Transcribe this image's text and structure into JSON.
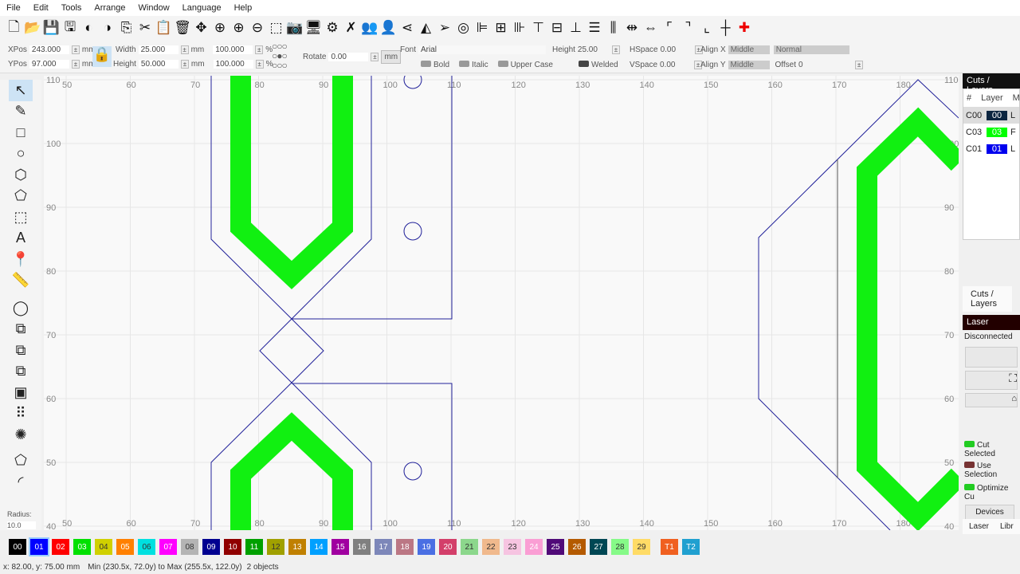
{
  "menu": [
    "File",
    "Edit",
    "Tools",
    "Arrange",
    "Window",
    "Language",
    "Help"
  ],
  "toolbar_icons": [
    "new-file",
    "open-folder",
    "save",
    "save-as",
    "undo",
    "redo",
    "copy",
    "cut",
    "paste",
    "delete",
    "move",
    "zoom-fit",
    "zoom-in",
    "zoom-out",
    "zoom-selection",
    "camera",
    "monitor",
    "settings",
    "tools",
    "users",
    "user",
    "flip-horizontal",
    "mirror",
    "send",
    "target",
    "align-left",
    "align-center",
    "align-right",
    "align-top",
    "align-middle",
    "align-bottom",
    "distribute-h",
    "distribute-v",
    "distribute-center",
    "space",
    "corner-tl",
    "corner-tr",
    "corner-bl",
    "crosshair",
    "red-crosshair"
  ],
  "props": {
    "xpos_label": "XPos",
    "xpos": "243.000",
    "ypos_label": "YPos",
    "ypos": "97.000",
    "unit": "mm",
    "width_label": "Width",
    "width": "25.000",
    "height_label": "Height",
    "height": "50.000",
    "wpct": "100.000",
    "hpct": "100.000",
    "pct": "%",
    "rotate_label": "Rotate",
    "rotate": "0.00",
    "mm_btn": "mm",
    "font_label": "Font",
    "font": "Arial",
    "theight_label": "Height",
    "theight": "25.00",
    "hspace_label": "HSpace",
    "hspace": "0.00",
    "vspace_label": "VSpace",
    "vspace": "0.00",
    "alignx_label": "Align X",
    "alignx": "Middle",
    "aligny_label": "Align Y",
    "aligny": "Middle",
    "mode": "Normal",
    "offset_label": "Offset",
    "offset": "0",
    "bold": "Bold",
    "italic": "Italic",
    "upper": "Upper Case",
    "welded": "Welded"
  },
  "left_tools": [
    "select",
    "pen",
    "rectangle",
    "ellipse",
    "polygon",
    "polygon-edit",
    "frame",
    "text",
    "position-pin",
    "measure",
    "offset",
    "boolean-union",
    "boolean-subtract",
    "boolean-intersect",
    "weld",
    "array-grid",
    "circular-array",
    "edit-nodes",
    "rounded-corner"
  ],
  "radius_label": "Radius:",
  "radius": "10.0",
  "rulers": {
    "x": [
      "50",
      "60",
      "70",
      "80",
      "90",
      "100",
      "110",
      "120",
      "130",
      "140",
      "150",
      "160",
      "170",
      "180"
    ],
    "y": [
      "110",
      "100",
      "90",
      "80",
      "70",
      "60",
      "50",
      "40"
    ]
  },
  "cuts": {
    "title": "Cuts / Layers",
    "cols": [
      "#",
      "Layer",
      "M"
    ],
    "rows": [
      {
        "id": "C00",
        "layer": "00",
        "color": "#0b2540",
        "mode": "L"
      },
      {
        "id": "C03",
        "layer": "03",
        "color": "#00ff00",
        "mode": "F"
      },
      {
        "id": "C01",
        "layer": "01",
        "color": "#0000ee",
        "mode": "L"
      }
    ],
    "tab": "Cuts / Layers"
  },
  "laser": {
    "title": "Laser",
    "status": "Disconnected",
    "cut_selected": "Cut Selected",
    "use_selection": "Use Selection",
    "optimize": "Optimize Cu",
    "devices": "Devices",
    "tabs": [
      "Laser",
      "Libr"
    ]
  },
  "palette": [
    [
      "00",
      "#000000"
    ],
    [
      "01",
      "#0000ff"
    ],
    [
      "02",
      "#ff0000"
    ],
    [
      "03",
      "#00e000"
    ],
    [
      "04",
      "#d0d000"
    ],
    [
      "05",
      "#ff8000"
    ],
    [
      "06",
      "#00e0e0"
    ],
    [
      "07",
      "#ff00ff"
    ],
    [
      "08",
      "#b4b4b4"
    ],
    [
      "09",
      "#000090"
    ],
    [
      "10",
      "#900000"
    ],
    [
      "11",
      "#00a000"
    ],
    [
      "12",
      "#a0a000"
    ],
    [
      "13",
      "#c08000"
    ],
    [
      "14",
      "#00a0ff"
    ],
    [
      "15",
      "#a000a0"
    ],
    [
      "16",
      "#808080"
    ],
    [
      "17",
      "#7d87b9"
    ],
    [
      "18",
      "#bb7784"
    ],
    [
      "19",
      "#4a6fe3"
    ],
    [
      "20",
      "#d33f6a"
    ],
    [
      "21",
      "#8cd78c"
    ],
    [
      "22",
      "#f0b98d"
    ],
    [
      "23",
      "#f6c4e1"
    ],
    [
      "24",
      "#fa9ed4"
    ],
    [
      "25",
      "#500a78"
    ],
    [
      "26",
      "#b45a00"
    ],
    [
      "27",
      "#004754"
    ],
    [
      "28",
      "#86fa88"
    ],
    [
      "29",
      "#ffdb66"
    ],
    [
      "T1",
      "#f06020"
    ],
    [
      "T2",
      "#20a0d0"
    ]
  ],
  "status": {
    "coords": "x: 82.00, y: 75.00 mm",
    "range": "Min (230.5x, 72.0y) to Max (255.5x, 122.0y)",
    "count": "2 objects"
  }
}
